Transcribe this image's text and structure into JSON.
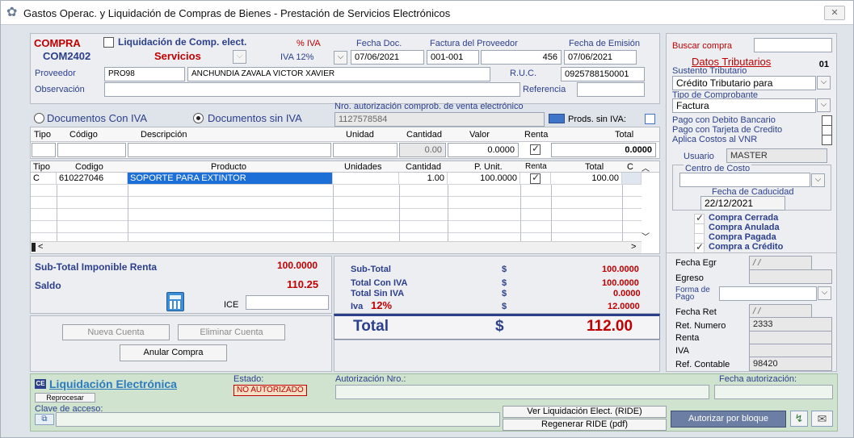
{
  "window": {
    "title": "Gastos Operac. y Liquidación de Compras de Bienes - Prestación de Servicios Electrónicos",
    "close_label": "✕"
  },
  "header": {
    "compra_label": "COMPRA",
    "liq_label": "Liquidación de Comp. elect.",
    "iva_pct_label": "% IVA",
    "fecha_doc_label": "Fecha Doc.",
    "factura_label": "Factura del Proveedor",
    "fecha_emision_label": "Fecha de Emisión",
    "compra_code": "COM2402",
    "tipo": "Servicios",
    "iva_rate": "IVA 12%",
    "fecha_doc": "07/06/2021",
    "factura_serie": "001-001",
    "factura_num": "456",
    "fecha_emision": "07/06/2021",
    "proveedor_label": "Proveedor",
    "proveedor_code": "PRO98",
    "proveedor_name": "ANCHUNDIA ZAVALA VICTOR XAVIER",
    "ruc_label": "R.U.C.",
    "ruc": "0925788150001",
    "observacion_label": "Observación",
    "referencia_label": "Referencia"
  },
  "docs": {
    "con_iva": "Documentos Con IVA",
    "sin_iva": "Documentos sin IVA",
    "nro_aut_label": "Nro. autorización comprob. de venta electrónico",
    "nro_aut": "1127578584",
    "prods_sin_iva": "Prods. sin IVA:"
  },
  "entry": {
    "headers": [
      "Tipo",
      "Código",
      "Descripción",
      "Unidad",
      "Cantidad",
      "Valor",
      "Renta",
      "Total"
    ],
    "cantidad": "0.00",
    "valor": "0.0000",
    "total": "0.0000"
  },
  "table": {
    "headers": [
      "Tipo",
      "Codigo",
      "Producto",
      "Unidades",
      "Cantidad",
      "P. Unit.",
      "Renta",
      "Total",
      "C"
    ],
    "rows": [
      {
        "tipo": "C",
        "codigo": "610227046",
        "producto": "SOPORTE PARA EXTINTOR",
        "unidades": "",
        "cantidad": "1.00",
        "punit": "100.0000",
        "total": "100.00"
      }
    ]
  },
  "totals": {
    "subtotal_renta_label": "Sub-Total Imponible Renta",
    "subtotal_renta": "100.0000",
    "saldo_label": "Saldo",
    "saldo": "110.25",
    "ice_label": "ICE",
    "subtotal_label": "Sub-Total",
    "subtotal": "100.0000",
    "con_iva_label": "Total  Con IVA",
    "con_iva": "100.0000",
    "sin_iva_label": "Total Sin IVA",
    "sin_iva": "0.0000",
    "iva_label": "Iva",
    "iva_pct": "12%",
    "iva": "12.0000",
    "total_label": "Total",
    "total": "112.00",
    "currency": "$"
  },
  "buttons": {
    "nueva": "Nueva Cuenta",
    "eliminar": "Eliminar Cuenta",
    "anular": "Anular Compra"
  },
  "right": {
    "buscar_label": "Buscar compra",
    "datos_trib": "Datos Tributarios",
    "datos_num": "01",
    "sustento_label": "Sustento Tributario",
    "sustento": "Crédito Tributario para",
    "tipo_comp_label": "Tipo de Comprobante",
    "tipo_comp": "Factura",
    "pago_debito": "Pago con Debito Bancario",
    "pago_tarjeta": "Pago con Tarjeta de Credito",
    "aplica_costos": "Aplica Costos al VNR",
    "usuario_label": "Usuario",
    "usuario": "MASTER",
    "centro_label": "Centro de Costo",
    "fecha_cad_label": "Fecha de Caducidad",
    "fecha_cad": "22/12/2021",
    "cerrada": "Compra Cerrada",
    "anulada": "Compra Anulada",
    "pagada": "Compra Pagada",
    "credito": "Compra a Crédito",
    "fecha_egr_label": "Fecha Egr",
    "fecha_egr": "/ /",
    "egreso_label": "Egreso",
    "forma_pago_label": "Forma de Pago",
    "fecha_ret_label": "Fecha Ret",
    "fecha_ret": "/ /",
    "ret_num_label": "Ret. Numero",
    "ret_num": "2333",
    "renta_label": "Renta",
    "iva_label": "IVA",
    "ref_contable_label": "Ref. Contable",
    "ref_contable": "98420"
  },
  "bottom": {
    "liq_label": "Liquidación Electrónica",
    "estado_label": "Estado:",
    "estado": "NO AUTORIZADO",
    "aut_label": "Autorización Nro.:",
    "fecha_aut_label": "Fecha autorización:",
    "reprocesar": "Reprocesar",
    "clave_label": "Clave de acceso:",
    "ver_ride": "Ver Liquidación Elect. (RIDE)",
    "regenerar": "Regenerar RIDE (pdf)",
    "autorizar": "Autorizar por bloque"
  },
  "colors": {
    "accent_blue": "#2c3f8c",
    "red": "#c00000",
    "select_blue": "#1b6fd6",
    "bottom_green": "#cfe3cf"
  }
}
